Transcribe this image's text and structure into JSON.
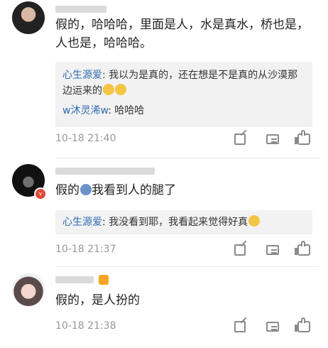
{
  "comments": [
    {
      "text": "假的，哈哈哈，里面是人，水是真水，桥也是，人也是，哈哈哈。",
      "replies": [
        {
          "user": "心生源爱",
          "text": ": 我以为是真的，还在想是不是真的从沙漠那边运来的",
          "emoji_count": 2
        },
        {
          "user": "w沐灵浠w",
          "text": ": 哈哈哈"
        }
      ],
      "timestamp": "10-18 21:40"
    },
    {
      "text": "假的",
      "text_after_emoji": "我看到人的腿了",
      "replies": [
        {
          "user": "心生源爱",
          "text": ": 我没看到耶，我看起来觉得好真"
        }
      ],
      "timestamp": "10-18 21:37"
    },
    {
      "text": "假的，是人扮的",
      "timestamp": "10-18 21:38"
    }
  ],
  "icons": {
    "edit": "pencil-square-icon",
    "reply": "chat-bubble-icon",
    "like": "thumbs-up-icon"
  },
  "colors": {
    "username": "#2f6bb3",
    "timestamp": "#999999",
    "reply_bg": "#f2f2f2",
    "vip_badge": "#e14a3b"
  }
}
